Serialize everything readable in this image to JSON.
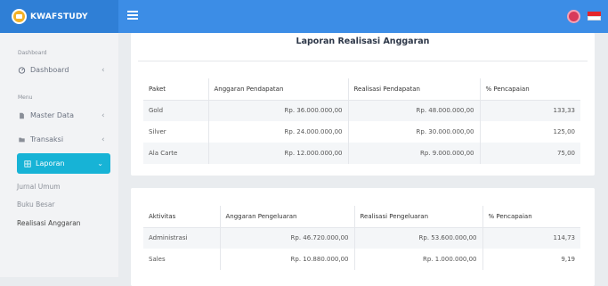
{
  "header": {
    "brand": "KWAFSTUDY",
    "menu_icon": "hamburger-icon",
    "user_icon": "user-avatar-icon",
    "lang_icon": "indonesia-flag-icon"
  },
  "sidebar": {
    "section_dashboard": "Dashboard",
    "dashboard": "Dashboard",
    "section_menu": "Menu",
    "master_data": "Master Data",
    "transaksi": "Transaksi",
    "laporan": "Laporan",
    "sub_items": [
      "Jurnal Umum",
      "Buku Besar",
      "Realisasi Anggaran"
    ]
  },
  "report": {
    "title": "Laporan Realisasi Anggaran",
    "income_table": {
      "headers": [
        "Paket",
        "Anggaran Pendapatan",
        "Realisasi Pendapatan",
        "% Pencapaian"
      ],
      "rows": [
        [
          "Gold",
          "Rp. 36.000.000,00",
          "Rp. 48.000.000,00",
          "133,33"
        ],
        [
          "Silver",
          "Rp. 24.000.000,00",
          "Rp. 30.000.000,00",
          "125,00"
        ],
        [
          "Ala Carte",
          "Rp. 12.000.000,00",
          "Rp. 9.000.000,00",
          "75,00"
        ]
      ]
    },
    "expense_table": {
      "headers": [
        "Aktivitas",
        "Anggaran Pengeluaran",
        "Realisasi Pengeluaran",
        "% Pencapaian"
      ],
      "rows": [
        [
          "Administrasi",
          "Rp. 46.720.000,00",
          "Rp. 53.600.000,00",
          "114,73"
        ],
        [
          "Sales",
          "Rp. 10.880.000,00",
          "Rp. 1.000.000,00",
          "9,19"
        ]
      ]
    }
  }
}
